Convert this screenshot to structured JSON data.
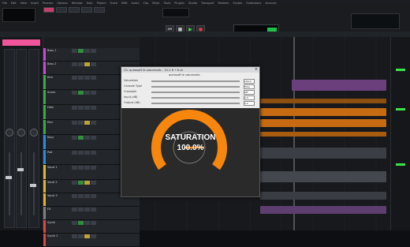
{
  "menu": [
    "File",
    "Edit",
    "View",
    "Insert",
    "Process",
    "Options",
    "Window",
    "Help",
    "Project",
    "Track",
    "MIDI",
    "Audio",
    "Clip",
    "Mixer",
    "Tools",
    "Plugins",
    "Studio",
    "Transport",
    "Markers",
    "Scripts",
    "Extensions",
    "Account"
  ],
  "plugin": {
    "title": "Ch: quirosoft tk saturmatic - 51.2 K • 6 ch",
    "subtitle": "quirosoft tk saturmatic",
    "rows": [
      {
        "label": "Saturation",
        "value": "100.0"
      },
      {
        "label": "Console Type",
        "value": "Tube"
      },
      {
        "label": "Crosstalk",
        "value": "Off"
      },
      {
        "label": "Input (dB)",
        "value": "0.0"
      },
      {
        "label": "Output (dB)",
        "value": "0.0"
      }
    ],
    "saturation_label": "SATURATION",
    "saturation_value": "100.0%",
    "saturation_level": 1.0,
    "accent": "#f7860f"
  },
  "tracks": [
    {
      "name": "Bass 1",
      "color": "#c24bd1"
    },
    {
      "name": "Bass 2",
      "color": "#c24bd1"
    },
    {
      "name": "Kick",
      "color": "#3da54a"
    },
    {
      "name": "Snare",
      "color": "#3da54a"
    },
    {
      "name": "Hats",
      "color": "#3da54a"
    },
    {
      "name": "Perc",
      "color": "#3da54a"
    },
    {
      "name": "Keys",
      "color": "#2d8bd6"
    },
    {
      "name": "Pad",
      "color": "#2d8bd6"
    },
    {
      "name": "Vocal 1",
      "color": "#d9b43a"
    },
    {
      "name": "Vocal 2",
      "color": "#d9b43a"
    },
    {
      "name": "Vocal 3",
      "color": "#d9b43a"
    },
    {
      "name": "FX",
      "color": "#7f7f7f"
    },
    {
      "name": "Synth",
      "color": "#d44a4a"
    },
    {
      "name": "Synth 2",
      "color": "#d44a4a"
    }
  ],
  "colors": {
    "clip_purple": "#7e4a8f",
    "clip_orange": "#c66b12",
    "clip_grey": "#4b4f56",
    "green": "#3de34a"
  }
}
